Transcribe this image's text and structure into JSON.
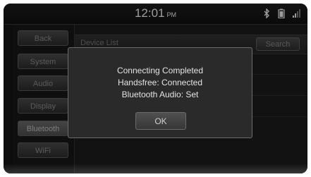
{
  "status_bar": {
    "time": "12:01",
    "ampm": "PM",
    "icons": [
      "bluetooth-icon",
      "battery-icon",
      "signal-icon"
    ]
  },
  "sidebar": {
    "items": [
      {
        "label": "Back"
      },
      {
        "label": "System"
      },
      {
        "label": "Audio"
      },
      {
        "label": "Display"
      },
      {
        "label": "Bluetooth",
        "active": true
      },
      {
        "label": "WiFi"
      }
    ]
  },
  "main": {
    "list_title": "Device List",
    "search_label": "Search"
  },
  "dialog": {
    "line1": "Connecting Completed",
    "line2": "Handsfree: Connected",
    "line3": "Bluetooth Audio: Set",
    "ok_label": "OK"
  }
}
